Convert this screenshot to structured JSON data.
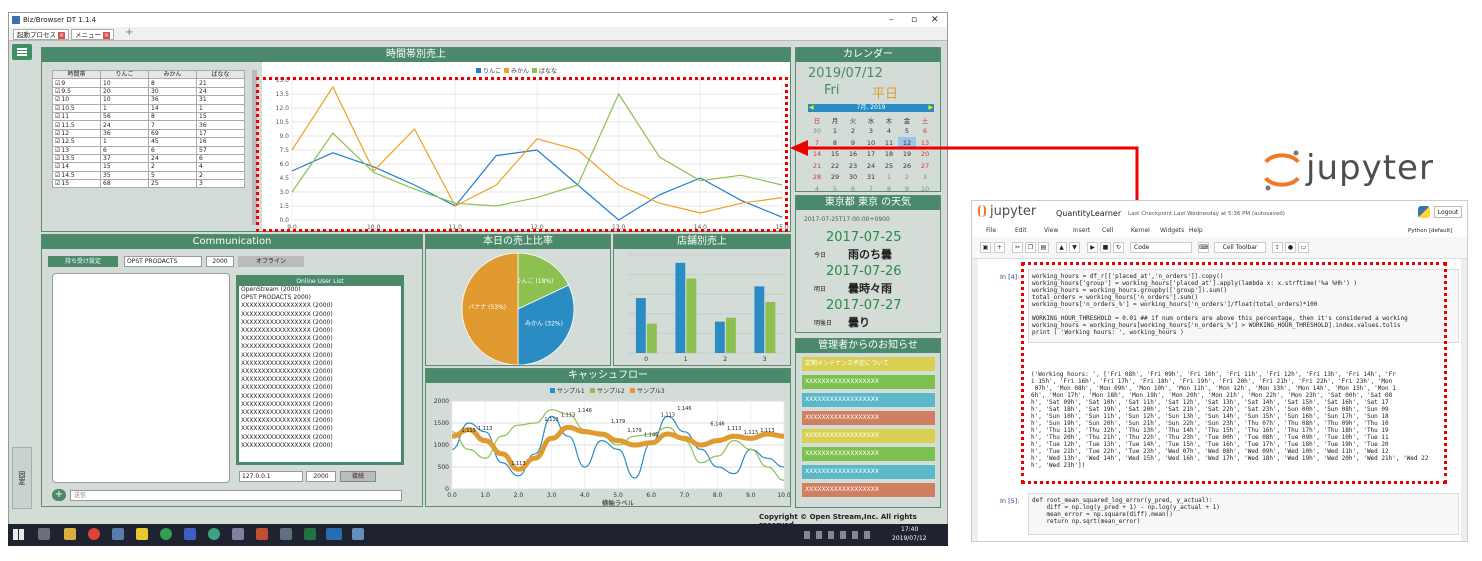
{
  "window": {
    "title": "Biz/Browser DT 1.1.4",
    "ctrl_min": "–",
    "ctrl_max": "▫",
    "ctrl_close": "✕"
  },
  "tabs": [
    {
      "label": "起動プロセス"
    },
    {
      "label": "メニュー"
    }
  ],
  "tab_add": "+",
  "side_label": "固定",
  "hourly": {
    "title": "時間帯別売上",
    "legend": [
      "りんご",
      "みかん",
      "ばなな"
    ],
    "columns": [
      "時間帯",
      "りんご",
      "みかん",
      "ばなな"
    ],
    "rows": [
      [
        "9",
        "10",
        "8",
        "21"
      ],
      [
        "9.5",
        "20",
        "30",
        "24"
      ],
      [
        "10",
        "10",
        "36",
        "31"
      ],
      [
        "10.5",
        "1",
        "14",
        "1"
      ],
      [
        "11",
        "56",
        "8",
        "15"
      ],
      [
        "11.5",
        "24",
        "7",
        "36"
      ],
      [
        "12",
        "36",
        "69",
        "17"
      ],
      [
        "12.5",
        "1",
        "45",
        "16"
      ],
      [
        "13",
        "6",
        "6",
        "57"
      ],
      [
        "13.5",
        "37",
        "24",
        "6"
      ],
      [
        "14",
        "15",
        "2",
        "4"
      ],
      [
        "14.5",
        "35",
        "5",
        "2"
      ],
      [
        "15",
        "68",
        "25",
        "3"
      ]
    ]
  },
  "chart_data": [
    {
      "type": "line",
      "title": "時間帯別売上",
      "x": [
        9,
        9.5,
        10,
        10.5,
        11,
        11.5,
        12,
        12.5,
        13,
        13.5,
        14,
        14.5,
        15
      ],
      "series": [
        {
          "name": "りんご",
          "color": "#1f7fd0",
          "values": [
            3.5,
            4.8,
            3.8,
            2.5,
            1.0,
            4.6,
            5.0,
            2.5,
            0.0,
            1.8,
            3.0,
            1.4,
            0.2
          ]
        },
        {
          "name": "みかん",
          "color": "#f0a020",
          "values": [
            5.0,
            9.5,
            3.5,
            6.5,
            1.0,
            2.5,
            5.8,
            5.0,
            2.5,
            1.2,
            0.5,
            1.2,
            1.6
          ]
        },
        {
          "name": "ばなな",
          "color": "#8cc050",
          "values": [
            2.0,
            6.2,
            3.4,
            2.2,
            1.2,
            1.0,
            1.6,
            2.5,
            9.0,
            4.5,
            2.8,
            3.2,
            2.5
          ]
        }
      ],
      "xlim": [
        9,
        15
      ],
      "ylim": [
        0,
        10
      ],
      "xticks": [
        "9.0",
        "10.0",
        "11.0",
        "12.0",
        "13.0",
        "14.0",
        "15.0"
      ],
      "yticks": [
        "0.0",
        "1.5",
        "3.0",
        "4.5",
        "6.0",
        "7.5",
        "9.0",
        "10.5",
        "12.0",
        "13.5",
        "15.0"
      ]
    },
    {
      "type": "pie",
      "title": "本日の売上比率",
      "slices": [
        {
          "label": "りんご (18%)",
          "value": 18,
          "color": "#8cc050"
        },
        {
          "label": "みかん (32%)",
          "value": 32,
          "color": "#2b8cc4"
        },
        {
          "label": "バナナ (53%)",
          "value": 50,
          "color": "#e09a30"
        }
      ]
    },
    {
      "type": "bar",
      "title": "店舗別売上",
      "categories": [
        "0",
        "1",
        "2",
        "3"
      ],
      "series": [
        {
          "values": [
            2.8,
            4.6,
            1.6,
            3.4
          ],
          "color": "#2b8cc4"
        },
        {
          "values": [
            1.5,
            3.8,
            1.8,
            2.6
          ],
          "color": "#8cc050"
        }
      ],
      "ylim": [
        0,
        5
      ]
    },
    {
      "type": "line",
      "title": "キャッシュフロー",
      "legend": [
        "サンプル1",
        "サンプル2",
        "サンプル3"
      ],
      "xlabel": "横軸ラベル",
      "x": [
        0,
        0.5,
        1,
        1.5,
        2,
        2.5,
        3,
        3.5,
        4,
        4.5,
        5,
        5.5,
        6,
        6.5,
        7,
        7.5,
        8,
        8.5,
        9,
        9.5,
        10
      ],
      "series": [
        {
          "name": "サンプル1",
          "color": "#2b8cc4",
          "values": [
            900,
            1500,
            1300,
            600,
            300,
            800,
            1650,
            1200,
            500,
            1100,
            900,
            250,
            1050,
            1650,
            1300,
            900,
            500,
            350,
            900,
            700,
            500
          ]
        },
        {
          "name": "サンプル2",
          "color": "#8cc050",
          "values": [
            1300,
            900,
            700,
            1200,
            1450,
            1500,
            1800,
            1700,
            1350,
            1200,
            1000,
            1200,
            1250,
            1400,
            1100,
            600,
            750,
            1100,
            900,
            500,
            200
          ]
        },
        {
          "name": "サンプル3",
          "color": "#e09a30",
          "values": [
            1200,
            1350,
            1100,
            800,
            450,
            700,
            1150,
            1400,
            1300,
            1250,
            1100,
            1000,
            1050,
            1250,
            1150,
            1000,
            1100,
            1200,
            1150,
            1250,
            1200
          ]
        }
      ],
      "data_labels": [
        "1,113",
        "1,113",
        "1,113",
        "1,146",
        "1,179",
        "1,179",
        "1,146",
        "1,146",
        "6,146",
        "1,113",
        "1,113",
        "1,113",
        "1,113",
        "1,113",
        "1,113"
      ],
      "xticks": [
        "0.0",
        "1.0",
        "2.0",
        "3.0",
        "4.0",
        "5.0",
        "6.0",
        "7.0",
        "8.0",
        "9.0",
        "10.0"
      ],
      "yticks": [
        "0",
        "500",
        "1000",
        "1500",
        "2000"
      ],
      "xlim": [
        0,
        10
      ],
      "ylim": [
        0,
        2000
      ]
    }
  ],
  "comm": {
    "title": "Communication",
    "btn_connect_setting": "持ち受け設定",
    "field_name": "OPST PRODACTS",
    "field_year": "2000",
    "status": "オフライン",
    "online_title": "Online User List",
    "users": [
      "OpenStream (2000)",
      "OPST PRODACTS 2000)",
      "XXXXXXXXXXXXXXXXX (2000)",
      "XXXXXXXXXXXXXXXXX (2000)",
      "XXXXXXXXXXXXXXXXX (2000)",
      "XXXXXXXXXXXXXXXXX (2000)",
      "XXXXXXXXXXXXXXXXX (2000)",
      "XXXXXXXXXXXXXXXXX (2000)",
      "XXXXXXXXXXXXXXXXX (2000)",
      "XXXXXXXXXXXXXXXXX (2000)",
      "XXXXXXXXXXXXXXXXX (2000)",
      "XXXXXXXXXXXXXXXXX (2000)",
      "XXXXXXXXXXXXXXXXX (2000)",
      "XXXXXXXXXXXXXXXXX (2000)",
      "XXXXXXXXXXXXXXXXX (2000)",
      "XXXXXXXXXXXXXXXXX (2000)",
      "XXXXXXXXXXXXXXXXX (2000)",
      "XXXXXXXXXXXXXXXXX (2000)",
      "XXXXXXXXXXXXXXXXX (2000)",
      "XXXXXXXXXXXXXXXXX (2000)"
    ],
    "ip": "127.0.0.1",
    "port": "2000",
    "connect_btn": "接続",
    "add_btn": "+",
    "send_placeholder": "送信"
  },
  "calendar": {
    "title": "カレンダー",
    "date": "2019/07/12",
    "weekday": "Fri",
    "day_type": "平日",
    "month_label": "7月, 2019",
    "prev": "◀",
    "next": "▶",
    "dow": [
      "日",
      "月",
      "火",
      "水",
      "木",
      "金",
      "土"
    ],
    "weeks": [
      [
        "30",
        "1",
        "2",
        "3",
        "4",
        "5",
        "6"
      ],
      [
        "7",
        "8",
        "9",
        "10",
        "11",
        "12",
        "13"
      ],
      [
        "14",
        "15",
        "16",
        "17",
        "18",
        "19",
        "20"
      ],
      [
        "21",
        "22",
        "23",
        "24",
        "25",
        "26",
        "27"
      ],
      [
        "28",
        "29",
        "30",
        "31",
        "1",
        "2",
        "3"
      ],
      [
        "4",
        "5",
        "6",
        "7",
        "8",
        "9",
        "10"
      ]
    ],
    "selected": "12"
  },
  "weather": {
    "title": "東京都 東京 の天気",
    "timestamp": "2017-07-25T17:00:00+0900",
    "days": [
      {
        "date": "2017-07-25",
        "label": "今日",
        "forecast": "雨のち曇"
      },
      {
        "date": "2017-07-26",
        "label": "明日",
        "forecast": "曇時々雨"
      },
      {
        "date": "2017-07-27",
        "label": "明後日",
        "forecast": "曇り"
      }
    ]
  },
  "notices": {
    "title": "管理者からのお知らせ",
    "items": [
      {
        "text": "定期メンテナンス予定について",
        "color": "#d8d050"
      },
      {
        "text": "XXXXXXXXXXXXXXXXXX",
        "color": "#7cc050"
      },
      {
        "text": "XXXXXXXXXXXXXXXXXX",
        "color": "#5ab8c8"
      },
      {
        "text": "XXXXXXXXXXXXXXXXXX",
        "color": "#d08060"
      },
      {
        "text": "XXXXXXXXXXXXXXXXXX",
        "color": "#d8d050"
      },
      {
        "text": "XXXXXXXXXXXXXXXXXX",
        "color": "#7cc050"
      },
      {
        "text": "XXXXXXXXXXXXXXXXXX",
        "color": "#5ab8c8"
      },
      {
        "text": "XXXXXXXXXXXXXXXXXX",
        "color": "#d08060"
      }
    ]
  },
  "copyright": "Copyright © Open Stream,Inc. All rights reserved.",
  "taskbar": {
    "time": "17:40",
    "date": "2019/07/12"
  },
  "jupyter": {
    "logo_text": "jupyter",
    "nb_name": "QuantityLearner",
    "checkpoint": "Last Checkpoint Last Wednesday at 5:36 PM (autosaved)",
    "logout": "Logout",
    "menu": [
      "File",
      "Edit",
      "View",
      "Insert",
      "Cell",
      "Kernel",
      "Widgets",
      "Help"
    ],
    "kernel": "Python [default]",
    "cell_type": "Code",
    "celltoolbar": "Cell Toolbar",
    "prompt1": "In [4]:",
    "prompt2": "In [5]:",
    "code1": [
      "working_hours = df_r[['placed_at','n_orders']].copy()",
      "working_hours['group'] = working_hours['placed_at'].apply(lambda x: x.strftime('%a %Hh') )",
      "working_hours = working_hours.groupby(['group']).sum()",
      "total_orders = working_hours['n_orders'].sum()",
      "working_hours['n_orders_%'] = working_hours['n_orders']/float(total_orders)*100",
      "",
      "WORKING_HOUR_THRESHOLD = 0.01 ## if num orders are above this percentage, then it's considered a working",
      "working_hours = working_hours[working_hours['n_orders_%'] > WORKING_HOUR_THRESHOLD].index.values.tolis",
      "print ( 'Working hours: ', working_hours )"
    ],
    "output1": [
      "('Working hours: ', ['Fri 08h', 'Fri 09h', 'Fri 10h', 'Fri 11h', 'Fri 12h', 'Fri 13h', 'Fri 14h', 'Fr",
      "i 15h', 'Fri 16h', 'Fri 17h', 'Fri 18h', 'Fri 19h', 'Fri 20h', 'Fri 21h', 'Fri 22h', 'Fri 23h', 'Mon",
      " 07h', 'Mon 08h', 'Mon 09h', 'Mon 10h', 'Mon 11h', 'Mon 12h', 'Mon 13h', 'Mon 14h', 'Mon 15h', 'Mon 1",
      "6h', 'Mon 17h', 'Mon 18h', 'Mon 19h', 'Mon 20h', 'Mon 21h', 'Mon 22h', 'Mon 23h', 'Sat 00h', 'Sat 08",
      "h', 'Sat 09h', 'Sat 10h', 'Sat 11h', 'Sat 12h', 'Sat 13h', 'Sat 14h', 'Sat 15h', 'Sat 16h', 'Sat 17",
      "h', 'Sat 18h', 'Sat 19h', 'Sat 20h', 'Sat 21h', 'Sat 22h', 'Sat 23h', 'Sun 00h', 'Sun 08h', 'Sun 09",
      "h', 'Sun 10h', 'Sun 11h', 'Sun 12h', 'Sun 13h', 'Sun 14h', 'Sun 15h', 'Sun 16h', 'Sun 17h', 'Sun 18",
      "h', 'Sun 19h', 'Sun 20h', 'Sun 21h', 'Sun 22h', 'Sun 23h', 'Thu 07h', 'Thu 08h', 'Thu 09h', 'Thu 10",
      "h', 'Thu 11h', 'Thu 12h', 'Thu 13h', 'Thu 14h', 'Thu 15h', 'Thu 16h', 'Thu 17h', 'Thu 18h', 'Thu 19",
      "h', 'Thu 20h', 'Thu 21h', 'Thu 22h', 'Thu 23h', 'Tue 00h', 'Tue 08h', 'Tue 09h', 'Tue 10h', 'Tue 11",
      "h', 'Tue 12h', 'Tue 13h', 'Tue 14h', 'Tue 15h', 'Tue 16h', 'Tue 17h', 'Tue 18h', 'Tue 19h', 'Tue 20",
      "h', 'Tue 21h', 'Tue 22h', 'Tue 23h', 'Wed 07h', 'Wed 08h', 'Wed 09h', 'Wed 10h', 'Wed 11h', 'Wed 12",
      "h', 'Wed 13h', 'Wed 14h', 'Wed 15h', 'Wed 16h', 'Wed 17h', 'Wed 18h', 'Wed 19h', 'Wed 20h', 'Wed 21h', 'Wed 22",
      "h', 'Wed 23h'])"
    ],
    "code2": [
      "def root_mean_squared_log_error(y_pred, y_actual):",
      "    diff = np.log(y_pred + 1) - np.log(y_actual + 1)",
      "    mean_error = np.square(diff).mean()",
      "    return np.sqrt(mean_error)"
    ]
  }
}
